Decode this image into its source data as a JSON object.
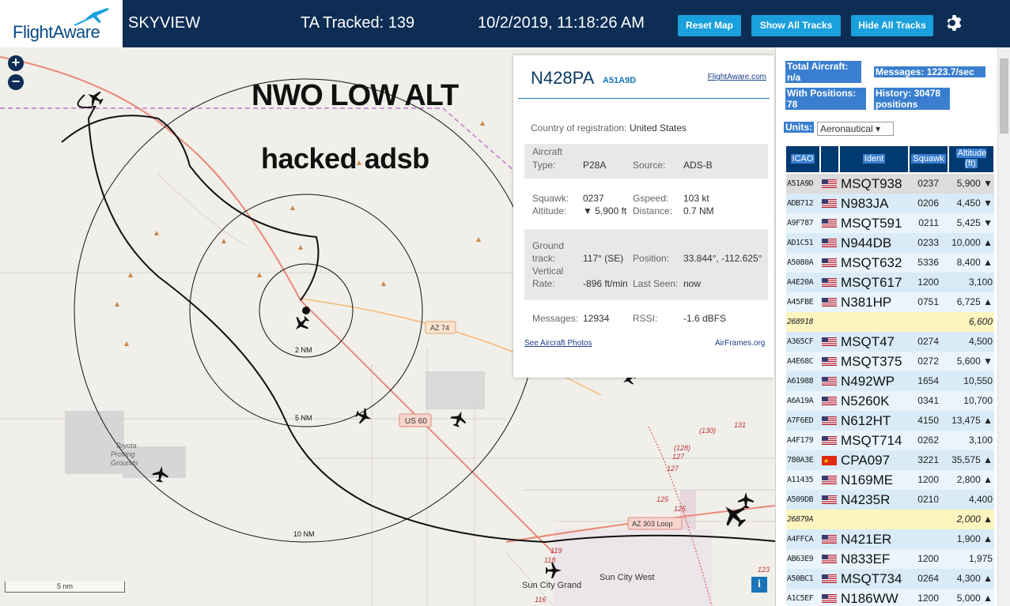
{
  "header": {
    "brand": "FlightAware",
    "app_title": "SKYVIEW",
    "tracked": "TA Tracked: 139",
    "clock": "10/2/2019, 11:18:26 AM",
    "btn_reset": "Reset Map",
    "btn_show": "Show All Tracks",
    "btn_hide": "Hide All Tracks"
  },
  "map": {
    "overlay_line1": "NWO LOW ALT",
    "overlay_line2": "hacked adsb",
    "zoom_in": "+",
    "zoom_out": "−",
    "ring_labels": [
      "2 NM",
      "5 NM",
      "10 NM"
    ],
    "road_labels": [
      "AZ 74",
      "US 60",
      "AZ 303 Loop"
    ],
    "place_labels": [
      "Toyota Proving Grounds",
      "Sun City Grand",
      "Sun City West"
    ],
    "road_numbers": [
      "(130)",
      "131",
      "(128)",
      "127",
      "127",
      "125",
      "125",
      "119",
      "118",
      "116",
      "123"
    ],
    "scale_label": "5 nm",
    "info_label": "i"
  },
  "popup": {
    "registration": "N428PA",
    "hex": "A51A9D",
    "fa_link": "FlightAware.com",
    "country_label": "Country of registration:",
    "country_value": "United States",
    "aircraft_label": "Aircraft",
    "type_label": "Type:",
    "type_value": "P28A",
    "source_label": "Source:",
    "source_value": "ADS-B",
    "squawk_label": "Squawk:",
    "squawk_value": "0237",
    "altitude_label": "Altitude:",
    "altitude_value": "▼ 5,900 ft",
    "gspeed_label": "Gspeed:",
    "gspeed_value": "103 kt",
    "distance_label": "Distance:",
    "distance_value": "0.7 NM",
    "ground_label": "Ground",
    "track_label": "track:",
    "track_value": "117° (SE)",
    "position_label": "Position:",
    "position_value": "33.844°, -112.625°",
    "vertical_label": "Vertical",
    "rate_label": "Rate:",
    "rate_value": "-896 ft/min",
    "lastseen_label": "Last Seen:",
    "lastseen_value": "now",
    "messages_label": "Messages:",
    "messages_value": "12934",
    "rssi_label": "RSSI:",
    "rssi_value": "-1.6 dBFS",
    "photos_link": "See Aircraft Photos",
    "airframes_link": "AirFrames.org"
  },
  "sidebar": {
    "total_aircraft": "Total Aircraft: n/a",
    "with_positions": "With Positions: 78",
    "messages": "Messages: 1223.7/sec",
    "history": "History: 30478 positions",
    "units_label": "Units:",
    "units_value": "Aeronautical ▾",
    "columns": [
      "ICAO",
      "Ident",
      "Squawk",
      "Altitude (ft)"
    ],
    "rows": [
      {
        "icao": "A51A9D",
        "flag": "us",
        "ident": "MSQT938",
        "squawk": "0237",
        "alt": "5,900 ▼",
        "style": "sel"
      },
      {
        "icao": "ADB712",
        "flag": "us",
        "ident": "N983JA",
        "squawk": "0206",
        "alt": "4,450 ▼",
        "style": "odd"
      },
      {
        "icao": "A9F787",
        "flag": "us",
        "ident": "MSQT591",
        "squawk": "0211",
        "alt": "5,425 ▼",
        "style": "even"
      },
      {
        "icao": "AD1C51",
        "flag": "us",
        "ident": "N944DB",
        "squawk": "0233",
        "alt": "10,000 ▲",
        "style": "odd"
      },
      {
        "icao": "A5080A",
        "flag": "us",
        "ident": "MSQT632",
        "squawk": "5336",
        "alt": "8,400 ▲",
        "style": "even"
      },
      {
        "icao": "A4E20A",
        "flag": "us",
        "ident": "MSQT617",
        "squawk": "1200",
        "alt": "3,100",
        "style": "odd"
      },
      {
        "icao": "A45FBE",
        "flag": "us",
        "ident": "N381HP",
        "squawk": "0751",
        "alt": "6,725 ▲",
        "style": "even"
      },
      {
        "icao": "268918",
        "flag": "",
        "ident": "",
        "squawk": "",
        "alt": "6,600",
        "style": "yellow"
      },
      {
        "icao": "A365CF",
        "flag": "us",
        "ident": "MSQT47",
        "squawk": "0274",
        "alt": "4,500",
        "style": "odd"
      },
      {
        "icao": "A4E68C",
        "flag": "us",
        "ident": "MSQT375",
        "squawk": "0272",
        "alt": "5,600 ▼",
        "style": "even"
      },
      {
        "icao": "A61988",
        "flag": "us",
        "ident": "N492WP",
        "squawk": "1654",
        "alt": "10,550",
        "style": "odd"
      },
      {
        "icao": "A6A19A",
        "flag": "us",
        "ident": "N5260K",
        "squawk": "0341",
        "alt": "10,700",
        "style": "even"
      },
      {
        "icao": "A7F6ED",
        "flag": "us",
        "ident": "N612HT",
        "squawk": "4150",
        "alt": "13,475 ▲",
        "style": "odd"
      },
      {
        "icao": "A4F179",
        "flag": "us",
        "ident": "MSQT714",
        "squawk": "0262",
        "alt": "3,100",
        "style": "even"
      },
      {
        "icao": "780A3E",
        "flag": "cn",
        "ident": "CPA097",
        "squawk": "3221",
        "alt": "35,575 ▲",
        "style": "odd"
      },
      {
        "icao": "A11435",
        "flag": "us",
        "ident": "N169ME",
        "squawk": "1200",
        "alt": "2,800 ▲",
        "style": "even"
      },
      {
        "icao": "A509DB",
        "flag": "us",
        "ident": "N4235R",
        "squawk": "0210",
        "alt": "4,400",
        "style": "odd"
      },
      {
        "icao": "26879A",
        "flag": "",
        "ident": "",
        "squawk": "",
        "alt": "2,000 ▲",
        "style": "yellow"
      },
      {
        "icao": "A4FFCA",
        "flag": "us",
        "ident": "N421ER",
        "squawk": "",
        "alt": "1,900 ▲",
        "style": "odd"
      },
      {
        "icao": "AB63E9",
        "flag": "us",
        "ident": "N833EF",
        "squawk": "1200",
        "alt": "1,975",
        "style": "even"
      },
      {
        "icao": "A50BC1",
        "flag": "us",
        "ident": "MSQT734",
        "squawk": "0264",
        "alt": "4,300 ▲",
        "style": "odd"
      },
      {
        "icao": "A1C5EF",
        "flag": "us",
        "ident": "N186WW",
        "squawk": "1200",
        "alt": "5,000 ▲",
        "style": "even"
      }
    ]
  },
  "colors": {
    "header_bg": "#0d2d54",
    "button_blue": "#1aa0dd",
    "highlight_blue": "#3a7fcf",
    "table_head": "#003a70",
    "row_selected": "#dcdcdc",
    "row_no_ident": "#fdf5c0"
  }
}
